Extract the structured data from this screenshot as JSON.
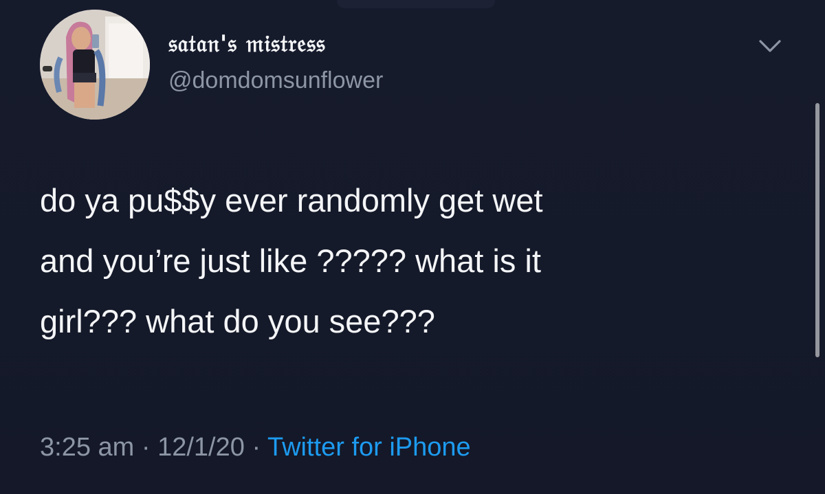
{
  "tweet": {
    "display_name": "𝔰𝔞𝔱𝔞𝔫'𝔰 𝔪𝔦𝔰𝔱𝔯𝔢𝔰𝔰",
    "handle": "@domdomsunflower",
    "text": "do ya pu$$y ever randomly get wet\nand you’re just like ????? what is it\ngirl??? what do you see???",
    "time": "3:25 am",
    "separator": "·",
    "date": "12/1/20",
    "source": "Twitter for iPhone"
  },
  "icons": {
    "menu": "chevron-down-icon",
    "avatar": "profile-photo"
  },
  "colors": {
    "background": "#161b2c",
    "primary_text": "#f4f5f7",
    "secondary_text": "#8d96a5",
    "link": "#1d9bf0"
  }
}
